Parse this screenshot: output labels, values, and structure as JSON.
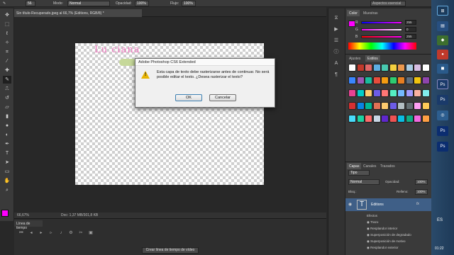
{
  "options_bar": {
    "size_value": "56",
    "mode_label": "Modo:",
    "mode_value": "Normal",
    "opacity_label": "Opacidad:",
    "opacity_value": "100%",
    "flow_label": "Flujo:",
    "flow_value": "100%",
    "workspace_search": "Aspectos esencial"
  },
  "document_tab": {
    "title": "Sin título-Recuperado.jpeg al 66,7% (Editions, RGB/8) *"
  },
  "canvas": {
    "layer_text": "Lu ciana"
  },
  "dialog": {
    "title": "Adobe Photoshop CS6 Extended",
    "message": "Esta capa de texto debe rasterizarse antes de continuar. No será posible editar el texto. ¿Desea rasterizar el texto?",
    "ok_label": "OK",
    "cancel_label": "Cancelar"
  },
  "status_bar": {
    "zoom": "66,67%",
    "doc_info": "Doc: 1,37 MB/301,8 KB"
  },
  "timeline": {
    "tab_label": "Línea de tiempo",
    "create_button": "Crear línea de tiempo de vídeo"
  },
  "color_panel": {
    "tabs": [
      "Color",
      "Muestras"
    ],
    "channels": [
      {
        "name": "R",
        "value": "255"
      },
      {
        "name": "G",
        "value": "0"
      },
      {
        "name": "B",
        "value": "255"
      }
    ],
    "foreground_color": "#ff00ff",
    "background_color": "#ffffff"
  },
  "styles_panel": {
    "tabs": [
      "Ajustes",
      "Estilos"
    ],
    "preset_colors": [
      "#ffffff",
      "#c0392b",
      "#e06666",
      "#5dade2",
      "#48c9b0",
      "#f4d03f",
      "#eb984e",
      "#a9cce3",
      "#d7bde2",
      "#ffffff",
      "#3a86ff",
      "#9b59b6",
      "#1abc9c",
      "#e74c3c",
      "#f39c12",
      "#2ecc71",
      "#e67e22",
      "#5d6d7e",
      "#f1c40f",
      "#8e44ad",
      "#e84393",
      "#00cec9",
      "#fdcb6e",
      "#6c5ce7",
      "#ff7675",
      "#55efc4",
      "#74b9ff",
      "#a29bfe",
      "#fab1a0",
      "#81ecec",
      "#d63031",
      "#0984e3",
      "#00b894",
      "#e17055",
      "#fdcb6e",
      "#6c5ce7",
      "#b2bec3",
      "#636e72",
      "#ff9ff3",
      "#feca57",
      "#48dbfb",
      "#1dd1a1",
      "#ff6b6b",
      "#c8d6e5",
      "#5f27cd",
      "#ee5253",
      "#0abde3",
      "#10ac84",
      "#f368e0",
      "#ff9f43"
    ]
  },
  "layers_panel": {
    "tabs": [
      "Capas",
      "Canales",
      "Trazados"
    ],
    "filter_label": "Tipo",
    "blend_mode": "Normal",
    "opacity_label": "Opacidad:",
    "opacity_value": "100%",
    "lock_label": "Bloq.:",
    "fill_label": "Relleno:",
    "fill_value": "100%",
    "layer_name": "Editions",
    "fx_label": "fx",
    "effects_label": "Efectos",
    "effects": [
      "Trazo",
      "Resplandor interior",
      "Superposición de degradado",
      "Superposición de motivo",
      "Resplandor exterior"
    ]
  },
  "taskbar": {
    "lang": "ES",
    "time": "01:22"
  }
}
